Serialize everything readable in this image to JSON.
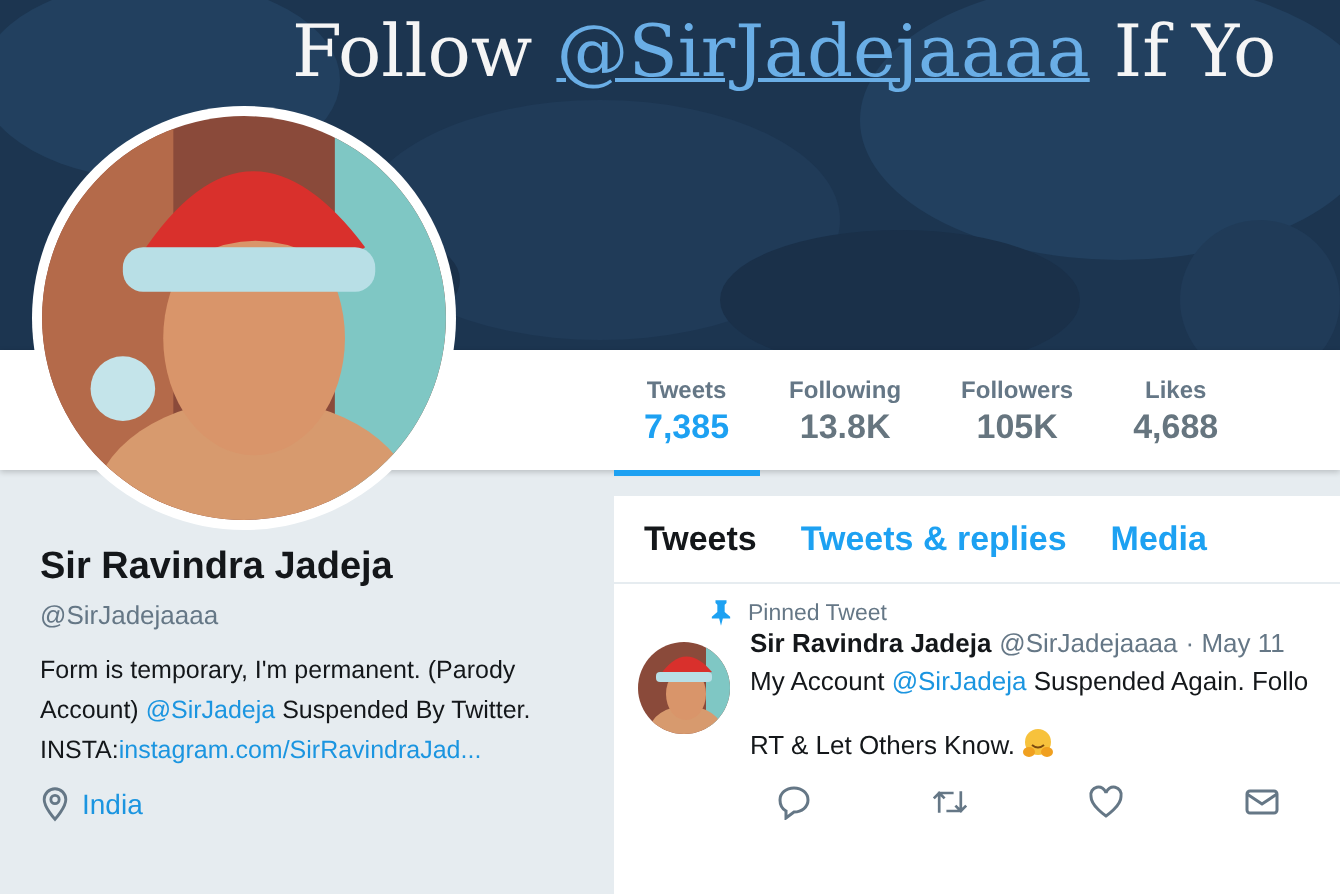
{
  "banner": {
    "parts": [
      {
        "text": "Follow",
        "kind": "plain"
      },
      {
        "text": "@SirJadejaaaa",
        "kind": "link"
      },
      {
        "text": "If Yo",
        "kind": "plain"
      }
    ]
  },
  "stats": [
    {
      "label": "Tweets",
      "value": "7,385",
      "selected": true
    },
    {
      "label": "Following",
      "value": "13.8K",
      "selected": false
    },
    {
      "label": "Followers",
      "value": "105K",
      "selected": false
    },
    {
      "label": "Likes",
      "value": "4,688",
      "selected": false
    }
  ],
  "profile": {
    "name": "Sir Ravindra Jadeja",
    "handle": "@SirJadejaaaa",
    "bio": [
      {
        "text": "Form is temporary, I'm permanent. (Parody Account) ",
        "kind": "plain"
      },
      {
        "text": "@SirJadeja",
        "kind": "link"
      },
      {
        "text": " Suspended By Twitter. INSTA:",
        "kind": "plain"
      },
      {
        "text": "instagram.com/SirRavindraJad...",
        "kind": "link"
      }
    ],
    "location": "India"
  },
  "timeline": {
    "tabs": [
      {
        "label": "Tweets",
        "selected": true
      },
      {
        "label": "Tweets & replies",
        "selected": false
      },
      {
        "label": "Media",
        "selected": false
      }
    ],
    "tweet": {
      "pinned_label": "Pinned Tweet",
      "name": "Sir Ravindra Jadeja",
      "handle": "@SirJadejaaaa",
      "date": "· May 11",
      "lines": [
        [
          {
            "text": "My Account ",
            "kind": "plain"
          },
          {
            "text": "@SirJadeja",
            "kind": "link"
          },
          {
            "text": " Suspended Again. Follo",
            "kind": "plain"
          }
        ],
        [
          {
            "text": "RT & Let Others Know.",
            "kind": "plain"
          }
        ]
      ]
    }
  }
}
